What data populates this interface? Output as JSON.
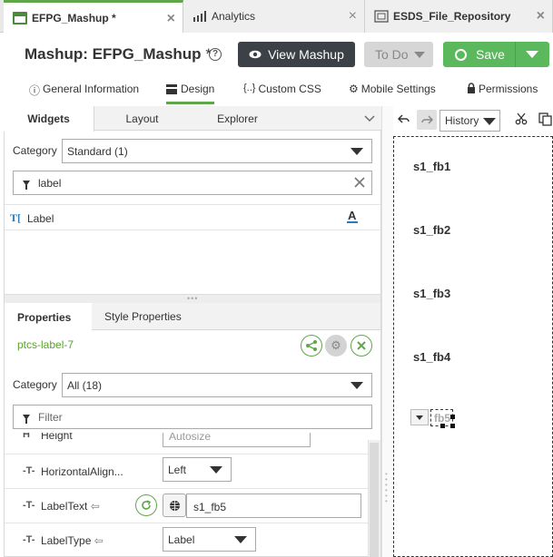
{
  "tabs": [
    {
      "label": "EFPG_Mashup *",
      "icon": "mashup-icon",
      "active": true
    },
    {
      "label": "Analytics",
      "icon": "analytics-chart-icon",
      "active": false
    },
    {
      "label": "ESDS_File_Repository",
      "icon": "file-repository-icon",
      "active": false
    }
  ],
  "close_glyph": "×",
  "header": {
    "title": "Mashup: EFPG_Mashup",
    "asterisk": "*",
    "help_glyph": "?",
    "view_label": "View Mashup",
    "todo_label": "To Do",
    "save_label": "Save"
  },
  "section_tabs": [
    {
      "label": "General Information",
      "icon": "info-icon"
    },
    {
      "label": "Design",
      "icon": "design-icon",
      "active": true
    },
    {
      "label": "Custom CSS",
      "icon": "css-braces-icon"
    },
    {
      "label": "Mobile Settings",
      "icon": "gear-icon"
    },
    {
      "label": "Permissions",
      "icon": "lock-icon"
    }
  ],
  "widget_tabs": {
    "widgets": "Widgets",
    "layout": "Layout",
    "explorer": "Explorer"
  },
  "widgets_panel": {
    "category_label": "Category",
    "category_value": "Standard (1)",
    "filter_value": "label",
    "results": [
      {
        "label": "Label",
        "icon": "text-label-icon"
      }
    ]
  },
  "properties_tabs": {
    "properties": "Properties",
    "style": "Style Properties"
  },
  "properties_panel": {
    "widget_id": "ptcs-label-7",
    "category_label": "Category",
    "category_value": "All (18)",
    "filter_placeholder": "Filter",
    "partial_row_name": "Height",
    "partial_row_value": "Autosize",
    "rows": [
      {
        "name": "HorizontalAlign...",
        "value": "Left",
        "type": "select"
      },
      {
        "name": "LabelText",
        "bindable": true,
        "value": "s1_fb5",
        "type": "text"
      },
      {
        "name": "LabelType",
        "bindable": true,
        "value": "Label",
        "type": "select"
      }
    ]
  },
  "canvas_toolbar": {
    "history_label": "History"
  },
  "canvas": {
    "labels": [
      "s1_fb1",
      "s1_fb2",
      "s1_fb3",
      "s1_fb4"
    ],
    "selected_label": "fb5"
  },
  "colors": {
    "accent_green": "#5fa64a",
    "save_green": "#5cb85c",
    "dark_button": "#3b4146",
    "id_green": "#5aa32e"
  }
}
